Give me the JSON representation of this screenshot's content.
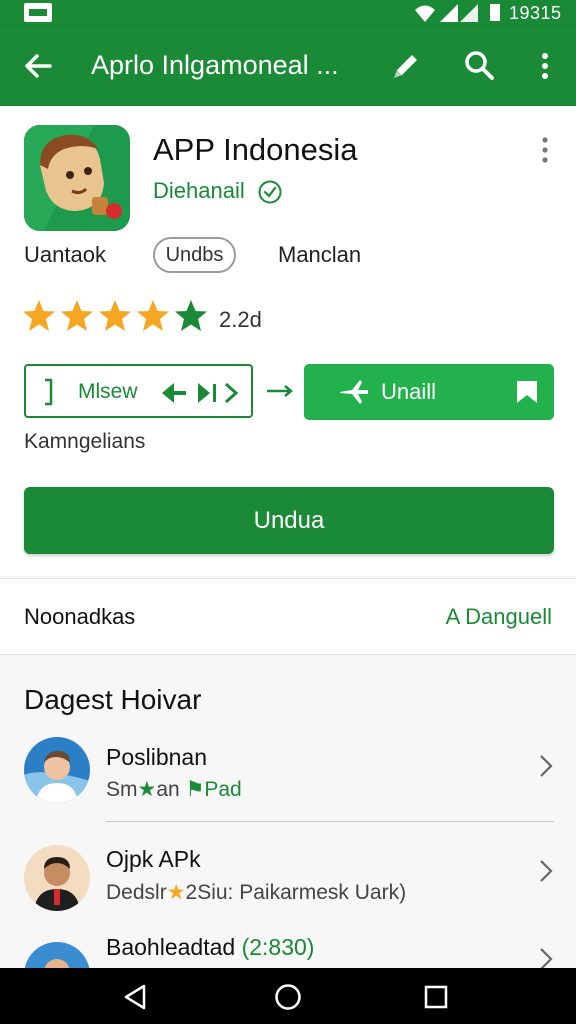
{
  "status": {
    "time": "19315"
  },
  "appbar": {
    "title": "Aprlo Inlgamoneal ..."
  },
  "app": {
    "name": "APP Indonesia",
    "developer": "Diehanail",
    "meta_left": "Uantaok",
    "meta_chip": "Undbs",
    "meta_right": "Manclan",
    "rating_value": 5,
    "rating_text": "2.2d"
  },
  "buttons": {
    "outline_label": "Mlsew",
    "green_label": "Unaill",
    "note": "Kamngelians",
    "install_label": "Undua"
  },
  "section1": {
    "left": "Noonadkas",
    "right": "A Danguell"
  },
  "section2": {
    "title": "Dagest Hoivar",
    "items": [
      {
        "name": "Poslibnan",
        "sub_a": "Sm",
        "sub_b": "an",
        "sub_c": "Pad"
      },
      {
        "name": "Ojpk APk",
        "sub_a": "Dedslr",
        "sub_b": "2Siu: Paikarmesk Uark)"
      },
      {
        "name": "Baohleadtad",
        "tag": "(2:830)"
      }
    ]
  },
  "colors": {
    "primary": "#1a8a36",
    "accent": "#22b14c",
    "star": "#f5a623"
  }
}
